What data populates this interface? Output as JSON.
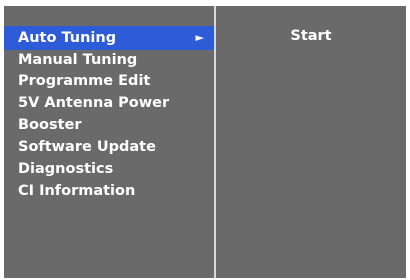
{
  "menu": {
    "items": [
      {
        "label": "Auto Tuning",
        "selected": true,
        "arrow": "►"
      },
      {
        "label": "Manual Tuning"
      },
      {
        "label": "Programme Edit"
      },
      {
        "label": "5V Antenna Power"
      },
      {
        "label": "Booster"
      },
      {
        "label": "Software Update"
      },
      {
        "label": "Diagnostics"
      },
      {
        "label": "CI Information"
      }
    ]
  },
  "submenu": {
    "items": [
      {
        "label": "Start"
      }
    ]
  },
  "colors": {
    "panel_bg": "#6a6a6a",
    "highlight": "#2e5cd8",
    "text": "#ffffff",
    "divider": "#d8d8d8"
  }
}
